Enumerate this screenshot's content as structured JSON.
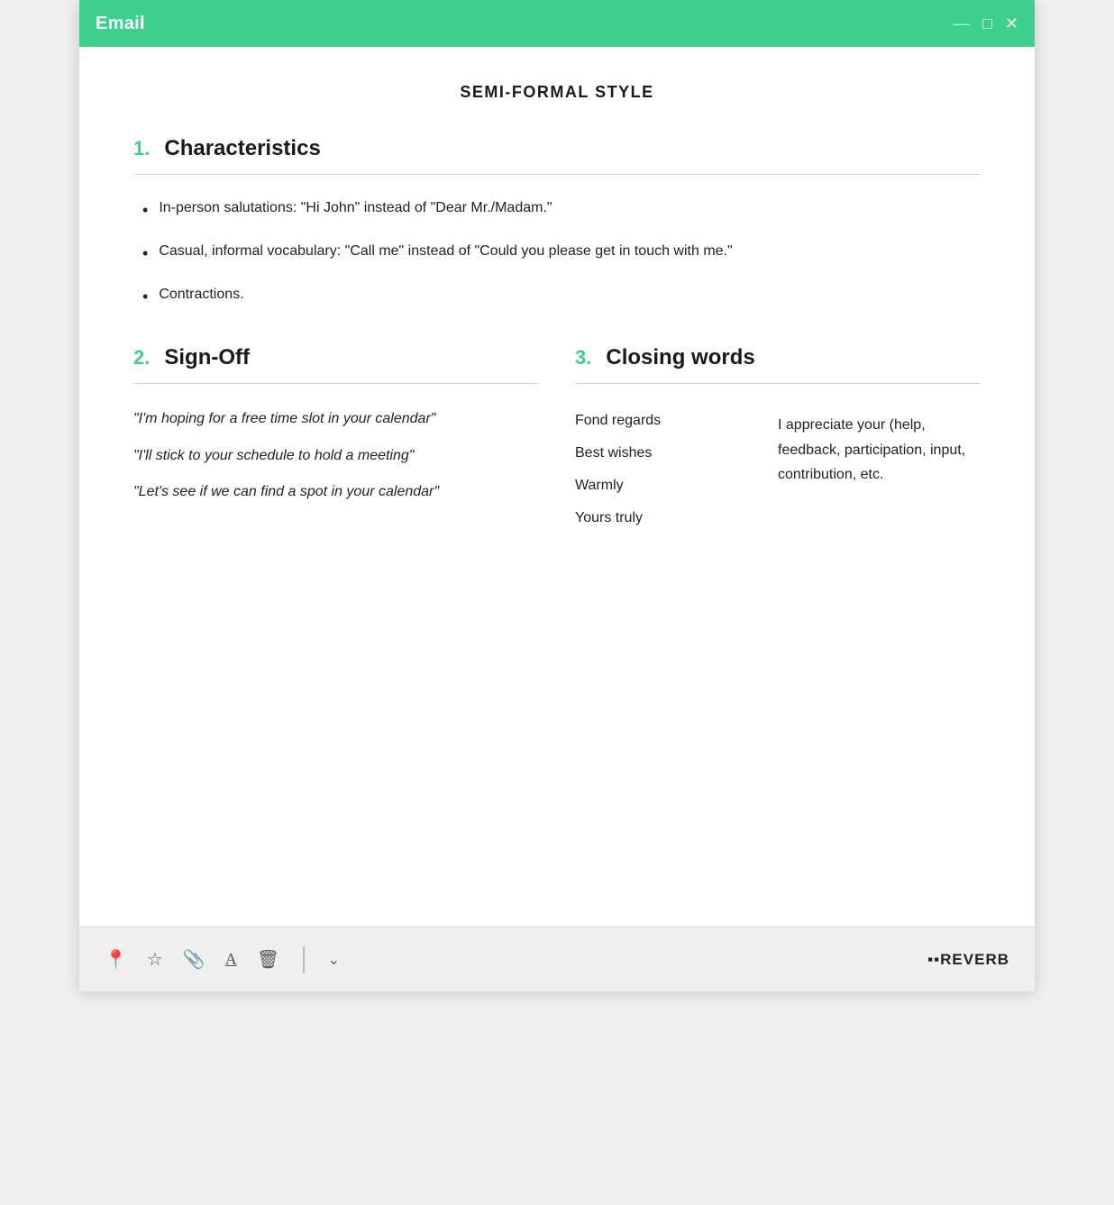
{
  "titlebar": {
    "title": "Email",
    "minimize": "—",
    "maximize": "□",
    "close": "✕"
  },
  "page": {
    "title": "SEMI-FORMAL STYLE"
  },
  "section1": {
    "number": "1.",
    "title": "Characteristics",
    "bullets": [
      "In-person salutations: \"Hi John\" instead of \"Dear Mr./Madam.\"",
      "Casual, informal vocabulary: \"Call me\" instead of \"Could you please get in touch with me.\"",
      "Contractions."
    ]
  },
  "section2": {
    "number": "2.",
    "title": "Sign-Off",
    "quotes": [
      "\"I'm hoping for a free time slot in your calendar\"",
      "\"I'll stick to your schedule to hold a meeting\"",
      "\"Let's see if we can find a spot in your calendar\""
    ]
  },
  "section3": {
    "number": "3.",
    "title": "Closing words",
    "words": [
      "Fond regards",
      "Best wishes",
      "Warmly",
      "Yours truly"
    ],
    "description": "I appreciate your (help, feedback, participation, input, contribution, etc."
  },
  "toolbar": {
    "icons": [
      "📍",
      "☆",
      "📎",
      "A",
      "🗑"
    ],
    "chevron": "∨"
  }
}
